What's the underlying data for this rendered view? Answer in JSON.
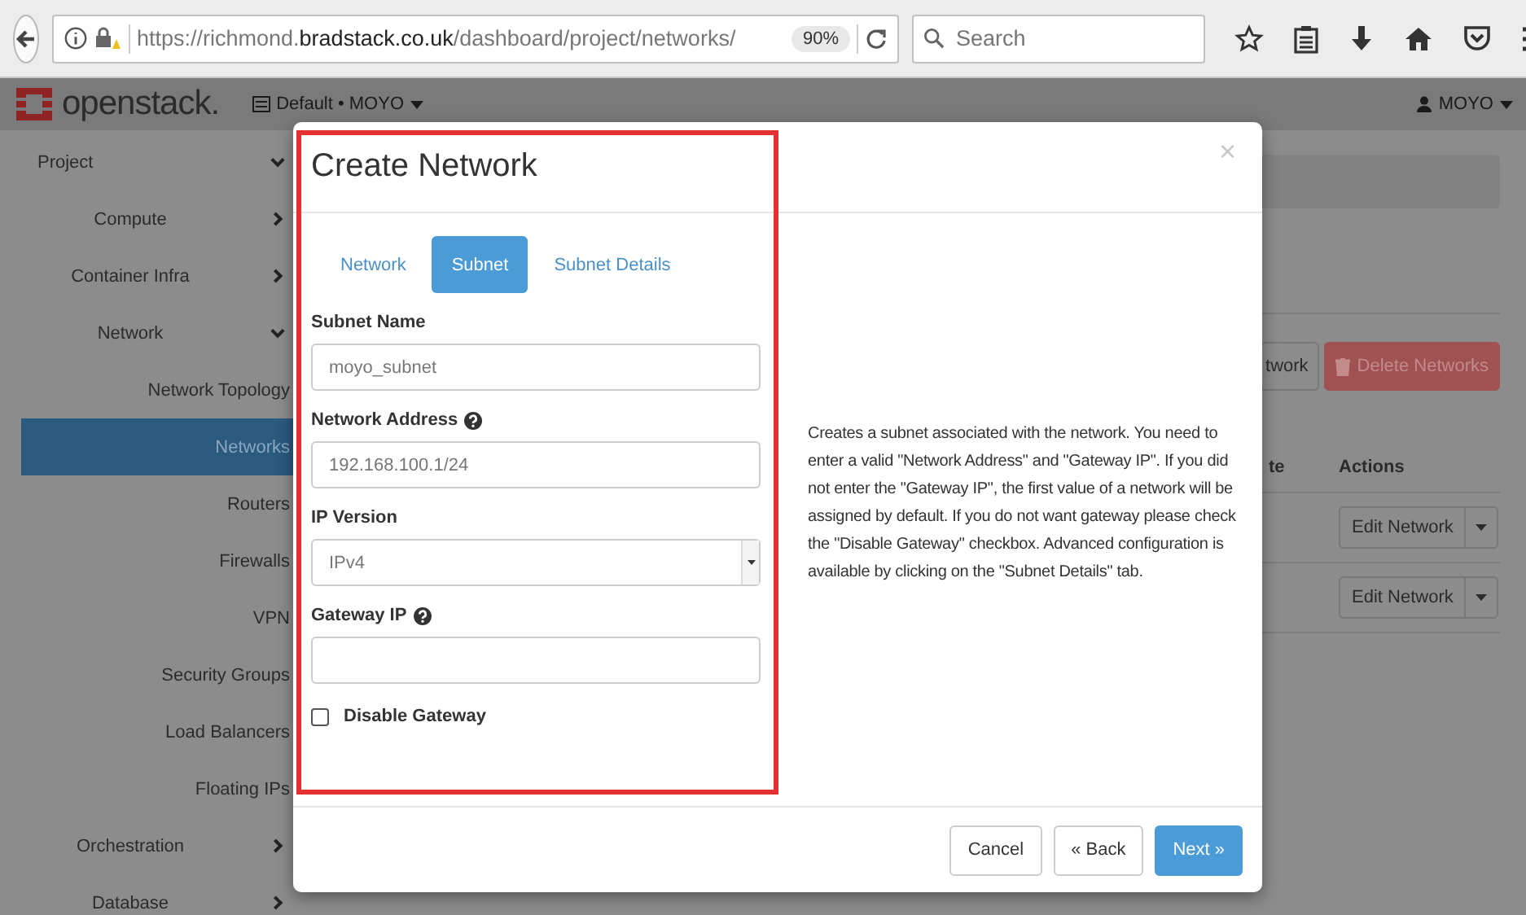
{
  "browser": {
    "url": "https://richmond.**bradstack.co.uk**/dashboard/project/networks/",
    "zoom": "90%",
    "search": {
      "placeholder": "Search"
    }
  },
  "topbar": {
    "logo": "openstack.",
    "project_menu": "Default • MOYO",
    "user_menu": "MOYO"
  },
  "sidebar": {
    "items": [
      {
        "label": "Project",
        "expanded": true,
        "children": [
          {
            "label": "Compute",
            "expanded": false
          },
          {
            "label": "Container Infra",
            "expanded": false
          },
          {
            "label": "Network",
            "expanded": true,
            "children": [
              {
                "label": "Network Topology",
                "selected": false
              },
              {
                "label": "Networks",
                "selected": true
              },
              {
                "label": "Routers",
                "selected": false
              },
              {
                "label": "Firewalls",
                "selected": false
              },
              {
                "label": "VPN",
                "selected": false
              },
              {
                "label": "Security Groups",
                "selected": false
              },
              {
                "label": "Load Balancers",
                "selected": false
              },
              {
                "label": "Floating IPs",
                "selected": false
              }
            ]
          },
          {
            "label": "Orchestration",
            "expanded": false
          },
          {
            "label": "Database",
            "expanded": false
          }
        ]
      }
    ]
  },
  "page": {
    "buttons": [
      {
        "label": "twork",
        "kind": "default"
      },
      {
        "label": "Delete Networks",
        "kind": "danger"
      }
    ],
    "table": {
      "columns": [
        "te",
        "Actions"
      ],
      "rows": [
        {
          "action": "Edit Network"
        },
        {
          "action": "Edit Network"
        }
      ]
    }
  },
  "modal": {
    "title": "Create Network",
    "close": "×",
    "tabs": [
      {
        "label": "Network",
        "selected": false
      },
      {
        "label": "Subnet",
        "selected": true
      },
      {
        "label": "Subnet Details",
        "selected": false
      }
    ],
    "fields": [
      {
        "label": "Subnet Name",
        "kind": "text",
        "help": false,
        "value": "moyo_subnet"
      },
      {
        "label": "Network Address",
        "kind": "text",
        "help": true,
        "value": "192.168.100.1/24"
      },
      {
        "label": "IP Version",
        "kind": "select",
        "help": false,
        "value": "IPv4"
      },
      {
        "label": "Gateway IP",
        "kind": "text",
        "help": true
      }
    ],
    "checkbox": {
      "label": "Disable Gateway",
      "checked": false
    },
    "help_text": "Creates a subnet associated with the network. You need to enter a valid \"Network Address\" and \"Gateway IP\". If you did not enter the \"Gateway IP\", the first value of a network will be assigned by default. If you do not want gateway please check the \"Disable Gateway\" checkbox. Advanced configuration is available by clicking on the \"Subnet Details\" tab.",
    "buttons": [
      {
        "label": "Cancel",
        "kind": "default"
      },
      {
        "label": "« Back",
        "kind": "default"
      },
      {
        "label": "Next »",
        "kind": "primary"
      }
    ]
  }
}
